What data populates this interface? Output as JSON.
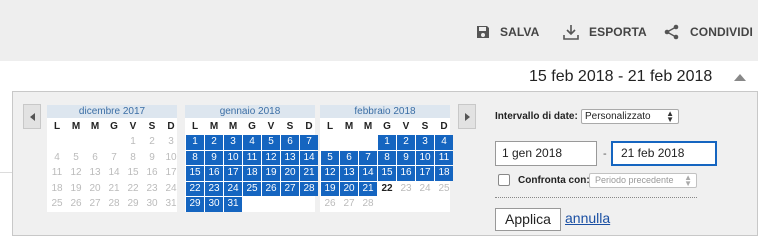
{
  "toolbar": {
    "save_label": "SALVA",
    "export_label": "ESPORTA",
    "share_label": "CONDIVIDI"
  },
  "date_range_display": "15 feb 2018 - 21 feb 2018",
  "calendar": {
    "weekdays": [
      "L",
      "M",
      "M",
      "G",
      "V",
      "S",
      "D"
    ],
    "months": [
      {
        "title": "dicembre 2017",
        "weeks": [
          [
            "",
            "",
            "",
            "",
            1,
            2,
            3
          ],
          [
            4,
            5,
            6,
            7,
            8,
            9,
            10
          ],
          [
            11,
            12,
            13,
            14,
            15,
            16,
            17
          ],
          [
            18,
            19,
            20,
            21,
            22,
            23,
            24
          ],
          [
            25,
            26,
            27,
            28,
            29,
            30,
            31
          ]
        ],
        "selected": []
      },
      {
        "title": "gennaio 2018",
        "weeks": [
          [
            1,
            2,
            3,
            4,
            5,
            6,
            7
          ],
          [
            8,
            9,
            10,
            11,
            12,
            13,
            14
          ],
          [
            15,
            16,
            17,
            18,
            19,
            20,
            21
          ],
          [
            22,
            23,
            24,
            25,
            26,
            27,
            28
          ],
          [
            29,
            30,
            31,
            "",
            "",
            "",
            ""
          ]
        ],
        "selected": [
          1,
          2,
          3,
          4,
          5,
          6,
          7,
          8,
          9,
          10,
          11,
          12,
          13,
          14,
          15,
          16,
          17,
          18,
          19,
          20,
          21,
          22,
          23,
          24,
          25,
          26,
          27,
          28,
          29,
          30,
          31
        ]
      },
      {
        "title": "febbraio 2018",
        "weeks": [
          [
            "",
            "",
            "",
            1,
            2,
            3,
            4
          ],
          [
            5,
            6,
            7,
            8,
            9,
            10,
            11
          ],
          [
            12,
            13,
            14,
            15,
            16,
            17,
            18
          ],
          [
            19,
            20,
            21,
            22,
            23,
            24,
            25
          ],
          [
            26,
            27,
            28,
            "",
            "",
            "",
            ""
          ]
        ],
        "selected": [
          1,
          2,
          3,
          4,
          5,
          6,
          7,
          8,
          9,
          10,
          11,
          12,
          13,
          14,
          15,
          16,
          17,
          18,
          19,
          20,
          21
        ],
        "today": 22
      }
    ]
  },
  "controls": {
    "interval_label": "Intervallo di date:",
    "interval_value": "Personalizzato",
    "from_value": "1 gen 2018",
    "separator": "-",
    "to_value": "21 feb 2018",
    "compare_label": "Confronta con:",
    "compare_value": "Periodo precedente",
    "compare_checked": false,
    "apply_label": "Applica",
    "cancel_label": "annulla"
  },
  "colors": {
    "selected": "#1565c0",
    "month_header_bg": "#dde6ef",
    "link": "#1a4fa3"
  }
}
